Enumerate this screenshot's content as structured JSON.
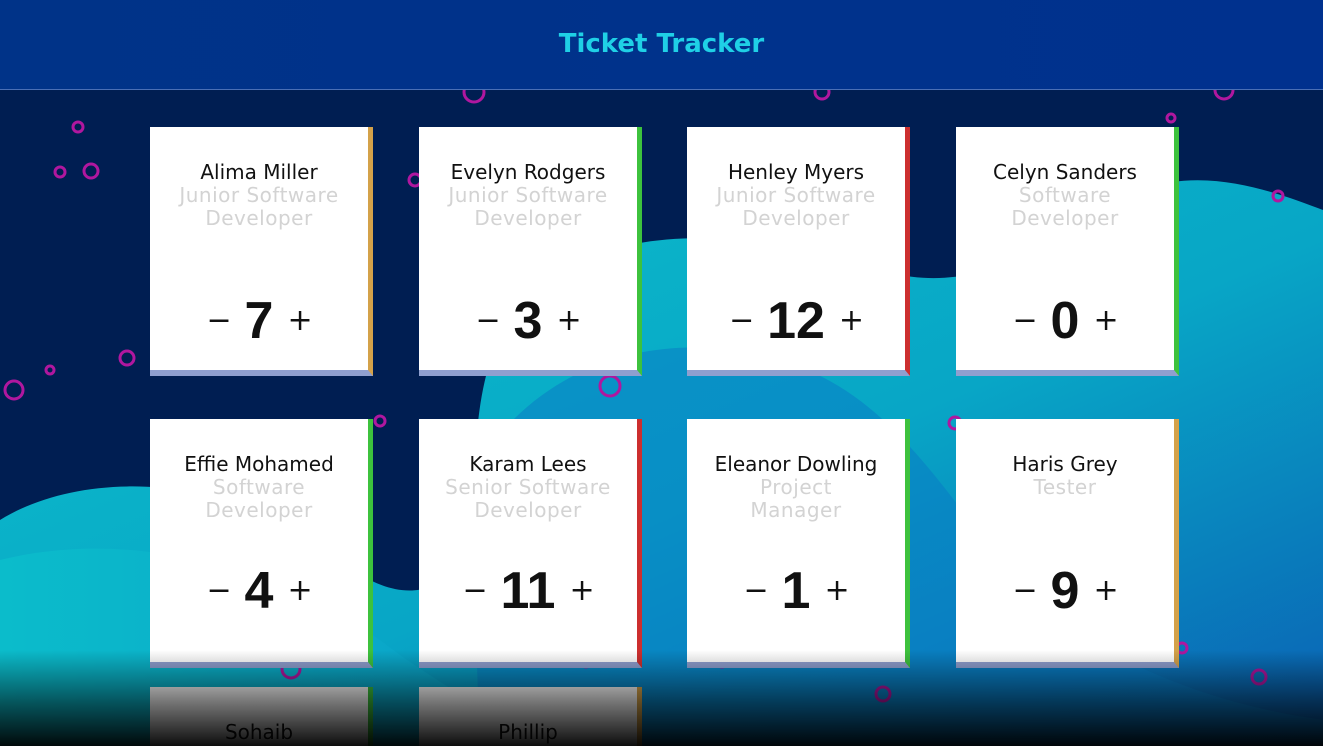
{
  "app": {
    "title": "Ticket Tracker"
  },
  "controls": {
    "decrement": "−",
    "increment": "+"
  },
  "colors": {
    "header_bg": "#003388",
    "title": "#1fd0e6",
    "page_bg": "#001e52",
    "wave": "#06b6c8",
    "status_green": "#3dc23d",
    "status_red": "#cc2f2f",
    "status_amber": "#d4a24a"
  },
  "team": [
    {
      "name": "Alima Miller",
      "role": "Junior Software Developer",
      "count": "7",
      "status": "amber"
    },
    {
      "name": "Evelyn Rodgers",
      "role": "Junior Software Developer",
      "count": "3",
      "status": "green"
    },
    {
      "name": "Henley Myers",
      "role": "Junior Software Developer",
      "count": "12",
      "status": "red"
    },
    {
      "name": "Celyn Sanders",
      "role": "Software Developer",
      "count": "0",
      "status": "green"
    },
    {
      "name": "Effie Mohamed",
      "role": "Software Developer",
      "count": "4",
      "status": "green"
    },
    {
      "name": "Karam Lees",
      "role": "Senior Software Developer",
      "count": "11",
      "status": "red"
    },
    {
      "name": "Eleanor Dowling",
      "role": "Project Manager",
      "count": "1",
      "status": "green"
    },
    {
      "name": "Haris Grey",
      "role": "Tester",
      "count": "9",
      "status": "amber"
    },
    {
      "name": "Sohaib",
      "role": "",
      "count": "",
      "status": "green"
    },
    {
      "name": "Phillip",
      "role": "",
      "count": "",
      "status": "amber"
    }
  ]
}
